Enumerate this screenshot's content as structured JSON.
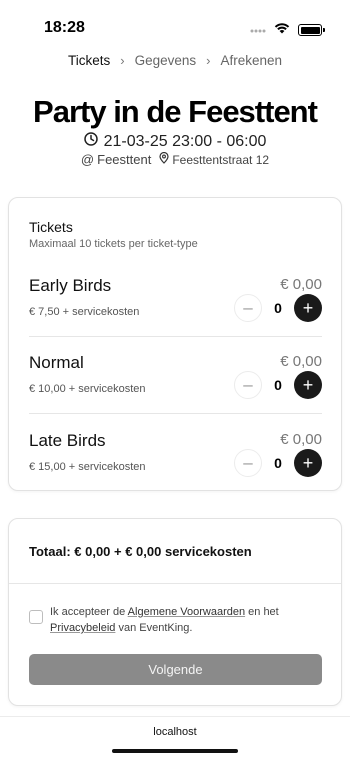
{
  "status_bar": {
    "time": "18:28",
    "icons": [
      "signal-dots-icon",
      "wifi-icon",
      "battery-icon"
    ]
  },
  "breadcrumb": {
    "items": [
      {
        "label": "Tickets",
        "active": true
      },
      {
        "label": "Gegevens",
        "active": false
      },
      {
        "label": "Afrekenen",
        "active": false
      }
    ]
  },
  "event": {
    "title": "Party in de Feesttent",
    "date": "21-03-25 23:00 - 06:00",
    "venue": "Feesttent",
    "address": "Feesttentstraat 12"
  },
  "tickets_card": {
    "title": "Tickets",
    "subtitle": "Maximaal 10 tickets per ticket-type",
    "tickets": [
      {
        "name": "Early Birds",
        "fee": "€ 7,50 + servicekosten",
        "price": "€ 0,00",
        "qty": "0"
      },
      {
        "name": "Normal",
        "fee": "€ 10,00 + servicekosten",
        "price": "€ 0,00",
        "qty": "0"
      },
      {
        "name": "Late Birds",
        "fee": "€ 15,00 + servicekosten",
        "price": "€ 0,00",
        "qty": "0"
      }
    ],
    "minus_symbol": "–",
    "plus_symbol": "+"
  },
  "summary": {
    "total": "Totaal: € 0,00 + € 0,00 servicekosten",
    "terms_part1": "Ik accepteer de ",
    "terms_link1": "Algemene Voorwaarden",
    "terms_part2": " en het ",
    "terms_link2": "Privacybeleid",
    "terms_part3": " van EventKing.",
    "terms_checked": false,
    "next_label": "Volgende"
  },
  "browser": {
    "url": "localhost"
  },
  "colors": {
    "primary_dark": "#1a1a1a",
    "button_disabled": "#8a8a8a",
    "border": "#e2e2e2",
    "muted_text": "#666666"
  }
}
